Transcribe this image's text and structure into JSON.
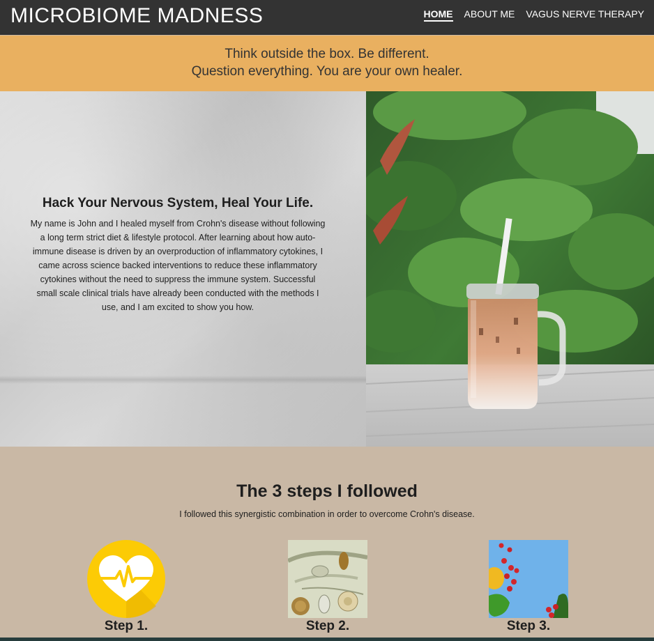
{
  "header": {
    "brand": "MICROBIOME MADNESS",
    "nav": [
      {
        "label": "HOME",
        "active": true
      },
      {
        "label": "ABOUT ME",
        "active": false
      },
      {
        "label": "VAGUS NERVE THERAPY",
        "active": false
      }
    ]
  },
  "banner": {
    "line1": "Think outside the box. Be different.",
    "line2": "Question everything. You are your own healer."
  },
  "hero": {
    "title": "Hack Your Nervous System, Heal Your Life.",
    "paragraph": "My name is John and I healed myself from Crohn's disease without following a long term strict diet & lifestyle protocol. After learning about how auto-immune disease is driven by an overproduction of inflammatory cytokines, I came across science backed interventions to reduce these inflammatory cytokines without the need to suppress the immune system. Successful small scale clinical trials have already been conducted with the methods I use, and I am excited to show you how."
  },
  "steps": {
    "title": "The 3 steps I followed",
    "subtitle": "I followed this synergistic combination in order to overcome Crohn's disease.",
    "items": [
      {
        "label": "Step 1."
      },
      {
        "label": "Step 2."
      },
      {
        "label": "Step 3."
      }
    ]
  },
  "colors": {
    "topbar": "#333333",
    "banner": "#e9b060",
    "section": "#c9b8a5",
    "heart_circle": "#fccb05"
  }
}
